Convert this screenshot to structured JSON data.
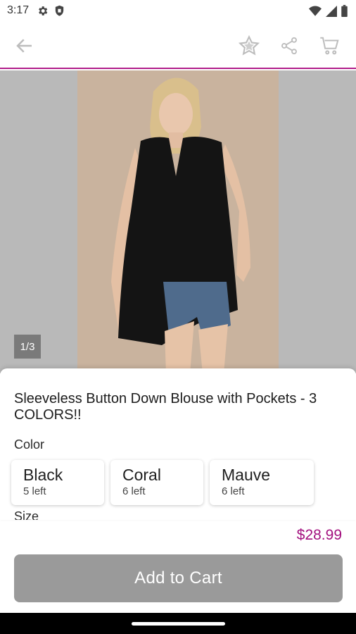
{
  "status_bar": {
    "time": "3:17",
    "icons": [
      "gear-icon",
      "shield-icon",
      "wifi-icon",
      "signal-icon",
      "battery-icon"
    ]
  },
  "app_bar": {
    "icons": [
      "back-arrow-icon",
      "star-icon",
      "share-icon",
      "cart-icon"
    ],
    "accent_color": "#b11c8a"
  },
  "gallery": {
    "page_indicator": "1/3"
  },
  "product": {
    "title": "Sleeveless Button Down Blouse with Pockets - 3 COLORS!!",
    "color_label": "Color",
    "size_label": "Size",
    "colors": [
      {
        "name": "Black",
        "stock": "5 left"
      },
      {
        "name": "Coral",
        "stock": "6 left"
      },
      {
        "name": "Mauve",
        "stock": "6 left"
      }
    ],
    "price": "$28.99",
    "price_color": "#a3117f"
  },
  "actions": {
    "add_to_cart_label": "Add to Cart"
  }
}
